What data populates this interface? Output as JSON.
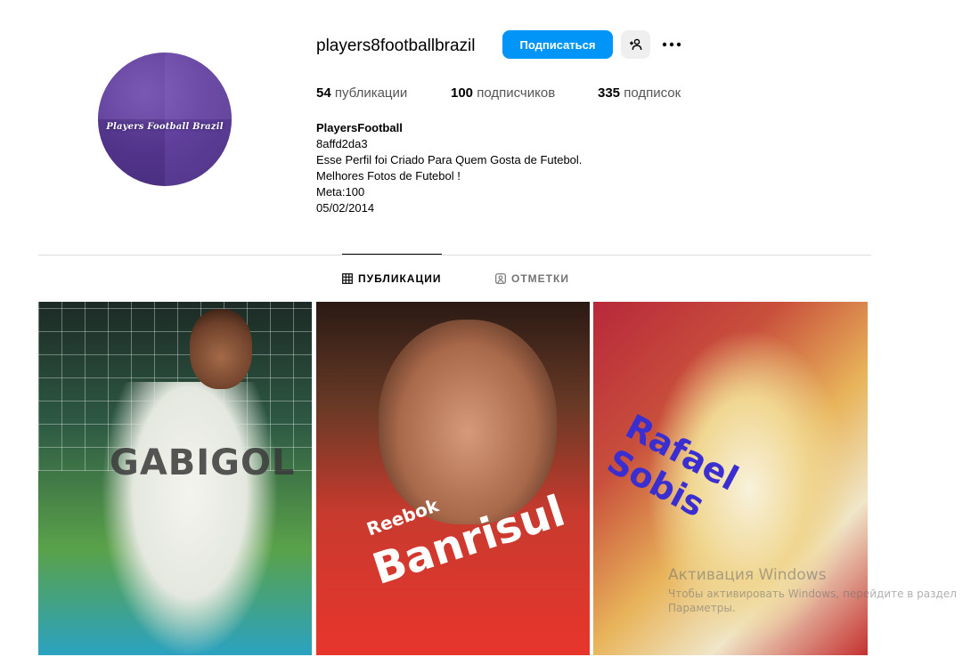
{
  "profile": {
    "username": "players8footballbrazil",
    "avatar_text": "Players Football Brazil",
    "follow_label": "Подписаться",
    "stats": {
      "posts_count": "54",
      "posts_label": "публикации",
      "followers_count": "100",
      "followers_label": "подписчиков",
      "following_count": "335",
      "following_label": "подписок"
    },
    "bio": {
      "name": "PlayersFootball",
      "line1": "8affd2da3",
      "line2": "Esse Perfil foi Criado Para Quem Gosta de Futebol.",
      "line3": "Melhores Fotos de Futebol !",
      "line4": "Meta:100",
      "line5": "05/02/2014"
    }
  },
  "tabs": [
    {
      "label": "ПУБЛИКАЦИИ",
      "icon": "grid-icon",
      "active": true
    },
    {
      "label": "ОТМЕТКИ",
      "icon": "tagged-icon",
      "active": false
    }
  ],
  "posts": [
    {
      "overlay_text": "GABIGOL"
    },
    {
      "overlay_text_small": "Reebok",
      "overlay_text_big": "Banrisul"
    },
    {
      "overlay_text": "Rafael Sobis"
    }
  ],
  "watermark": {
    "title": "Активация Windows",
    "line1": "Чтобы активировать Windows, перейдите в раздел",
    "line2": "Параметры."
  },
  "colors": {
    "accent": "#0095f6",
    "secondary_button": "#efefef",
    "divider": "#dbdbdb",
    "muted_text": "#737373"
  }
}
